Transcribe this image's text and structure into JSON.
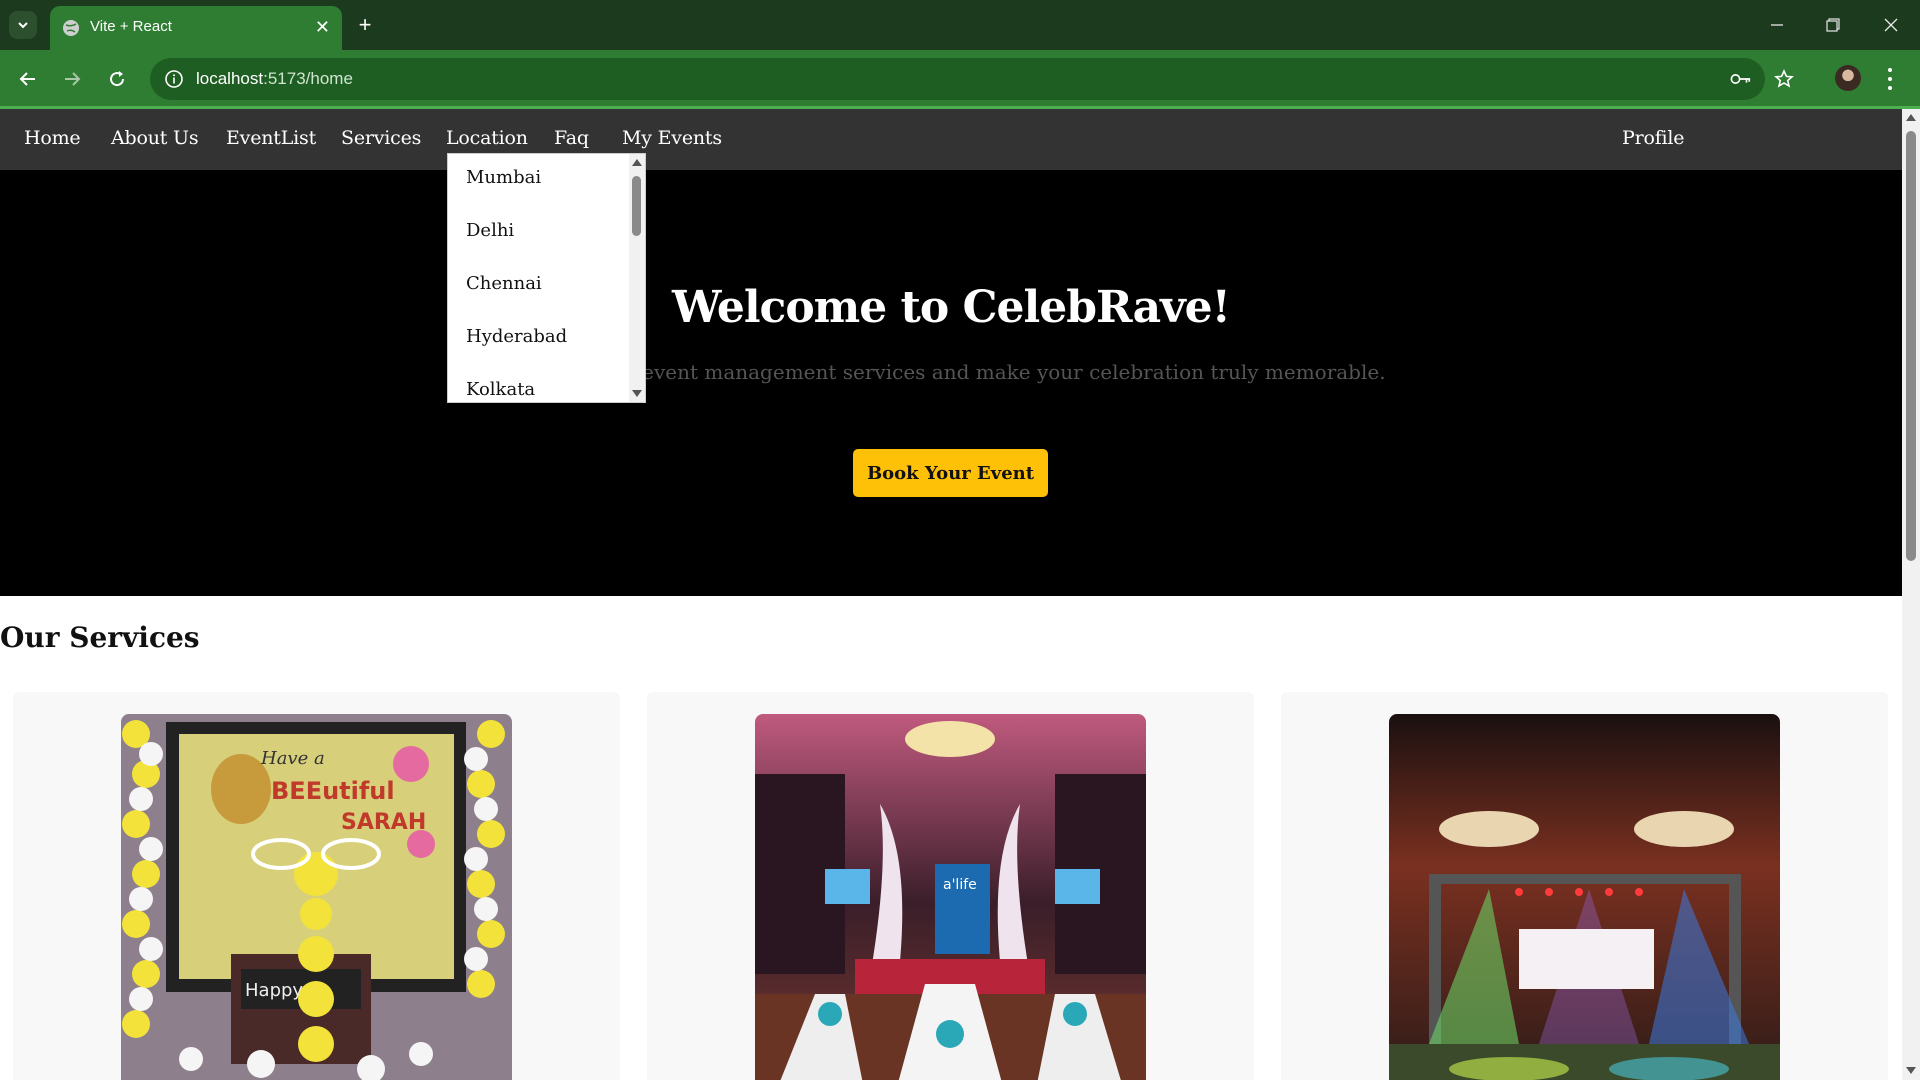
{
  "browser": {
    "tab_title": "Vite + React",
    "url_host": "localhost",
    "url_path": ":5173/home",
    "icons": [
      "tab-list-icon",
      "globe-icon",
      "close-icon",
      "plus-icon",
      "minimize-icon",
      "maximize-icon",
      "window-close-icon",
      "back-icon",
      "forward-icon",
      "reload-icon",
      "info-icon",
      "key-icon",
      "star-icon",
      "avatar",
      "menu-icon"
    ]
  },
  "nav": {
    "items": [
      "Home",
      "About Us",
      "EventList",
      "Services",
      "Location",
      "Faq",
      "My Events"
    ],
    "profile": "Profile"
  },
  "location_dropdown": {
    "options": [
      "Mumbai",
      "Delhi",
      "Chennai",
      "Hyderabad",
      "Kolkata"
    ]
  },
  "hero": {
    "title": "Welcome to CelebRave!",
    "subtitle": "Explore our event management services and make your celebration truly memorable.",
    "button": "Book Your Event"
  },
  "services": {
    "title": "Our Services",
    "cards": [
      {
        "image": "birthday-balloon-decoration-photo"
      },
      {
        "image": "banquet-hall-stage-photo"
      },
      {
        "image": "concert-stage-lighting-photo"
      }
    ]
  },
  "colors": {
    "chrome": "#2e7d32",
    "nav": "#333333",
    "hero": "#000000",
    "accent": "#ffc107"
  }
}
